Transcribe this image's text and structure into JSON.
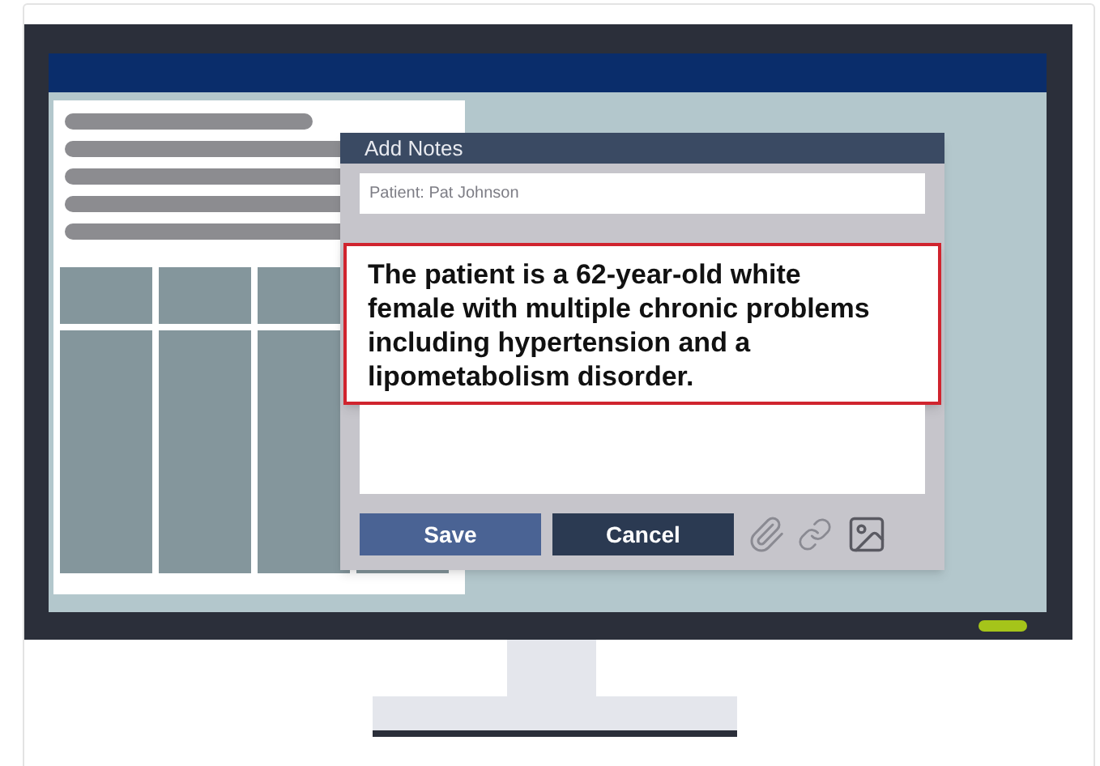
{
  "dialog": {
    "title": "Add Notes",
    "patient_field": {
      "value": "Patient: Pat Johnson"
    },
    "note": {
      "text": "The patient is a 62-year-old white female with multiple chronic problems including hypertension and a lipometabolism disorder.",
      "highlighted": true
    },
    "buttons": [
      {
        "label": "Save",
        "kind": "primary"
      },
      {
        "label": "Cancel",
        "kind": "secondary"
      }
    ]
  },
  "monitor": {
    "power_on": true
  }
}
